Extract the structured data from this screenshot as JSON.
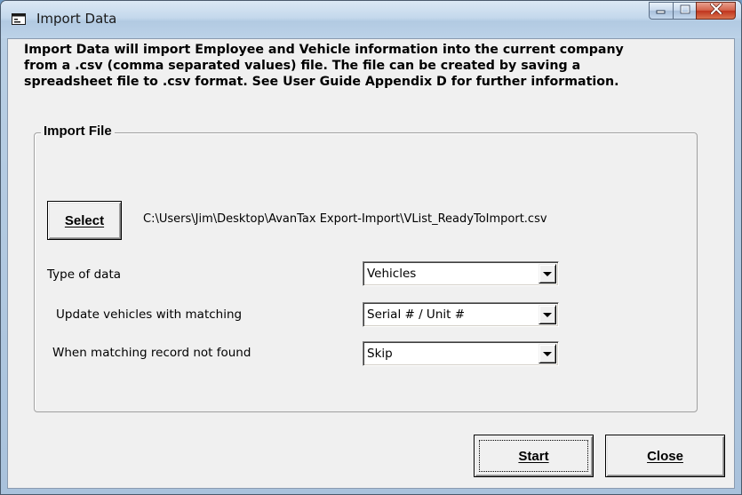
{
  "window": {
    "title": "Import Data"
  },
  "intro_text": "Import Data will import Employee and Vehicle information into the current company\nfrom a .csv (comma separated values) file. The file can be created by saving a\nspreadsheet file to .csv format. See User Guide Appendix D for further information.",
  "import_file": {
    "group_title": "Import File",
    "select_label": "Select",
    "file_path": "C:\\Users\\Jim\\Desktop\\AvanTax Export-Import\\VList_ReadyToImport.csv"
  },
  "fields": {
    "type_of_data": {
      "label": "Type of data",
      "value": "Vehicles"
    },
    "update_matching": {
      "label": "Update vehicles with matching",
      "value": "Serial # / Unit #"
    },
    "not_found": {
      "label": "When matching record not found",
      "value": "Skip"
    }
  },
  "buttons": {
    "start": "Start",
    "close": "Close"
  },
  "colors": {
    "close_button_red": "#c0341e",
    "dialog_face": "#f0f0f0"
  },
  "icons": {
    "app": "window-app-icon",
    "minimize": "minimize-icon",
    "maximize": "maximize-icon",
    "close": "close-x-icon",
    "dropdown": "dropdown-arrow-icon"
  }
}
